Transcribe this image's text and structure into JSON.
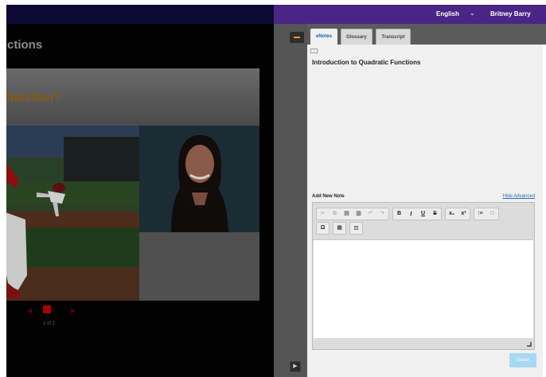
{
  "header": {
    "language": "English",
    "language_chevron": "chevron-down-icon",
    "user_name": "Britney Barry"
  },
  "lesson": {
    "title_fragment": "ctions",
    "slide_question_fragment": "function?",
    "page_indicator": "1 of 2"
  },
  "tabs": [
    {
      "label": "eNotes",
      "active": true
    },
    {
      "label": "Glossary",
      "active": false
    },
    {
      "label": "Transcript",
      "active": false
    }
  ],
  "notes": {
    "note_title": "Introduction to Quadratic Functions",
    "add_label": "Add New Note",
    "hide_advanced": "Hide Advanced",
    "submit": "Submit"
  },
  "toolbar": {
    "row1": [
      [
        "cut",
        "copy",
        "paste",
        "paste-text",
        "undo",
        "redo"
      ],
      [
        "bold",
        "italic",
        "underline",
        "strikethrough"
      ],
      [
        "subscript",
        "superscript"
      ],
      [
        "numbered-list",
        "bulleted-list"
      ]
    ],
    "row2": [
      [
        "special-character"
      ],
      [
        "table"
      ],
      [
        "math"
      ]
    ]
  },
  "colors": {
    "accent_purple": "#4b2585",
    "collapse_orange": "#f0a020",
    "link_blue": "#1f6fb8",
    "submit_blue": "#a9d8f5"
  }
}
